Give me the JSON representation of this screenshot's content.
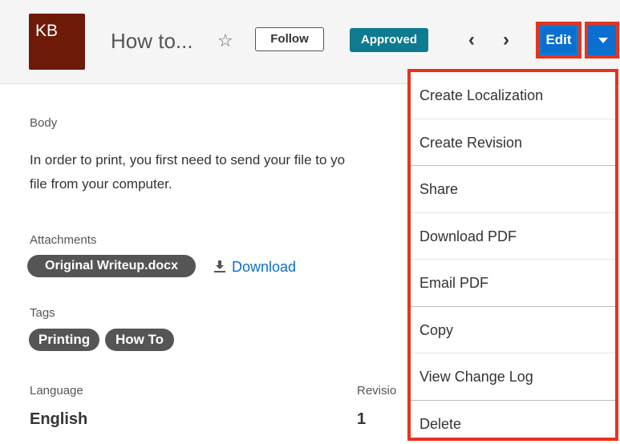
{
  "header": {
    "avatar_initials": "KB",
    "title": "How to...",
    "follow_label": "Follow",
    "status": "Approved",
    "edit_label": "Edit"
  },
  "record": {
    "body_label": "Body",
    "body_line1": "In order to print, you first need to send your file to yo",
    "body_line2": "file from your computer.",
    "attachments_label": "Attachments",
    "attachment_name": "Original Writeup.docx",
    "download_label": "Download",
    "tags_label": "Tags",
    "tags": [
      "Printing",
      "How To"
    ],
    "language_label": "Language",
    "language_value": "English",
    "revision_label": "Revisio",
    "revision_value": "1"
  },
  "menu": {
    "items": [
      "Create Localization",
      "Create Revision",
      "Share",
      "Download PDF",
      "Email PDF",
      "Copy",
      "View Change Log",
      "Delete"
    ]
  },
  "colors": {
    "avatar_bg": "#6e1a08",
    "status_badge": "#0e7b90",
    "primary_button": "#0a6fd0",
    "highlight_outline": "#e8331c",
    "link": "#0a6fd0"
  },
  "icons": {
    "follow": "star-outline-icon",
    "prev": "chevron-left-icon",
    "next": "chevron-right-icon",
    "actions": "caret-down-icon",
    "download": "download-icon"
  }
}
